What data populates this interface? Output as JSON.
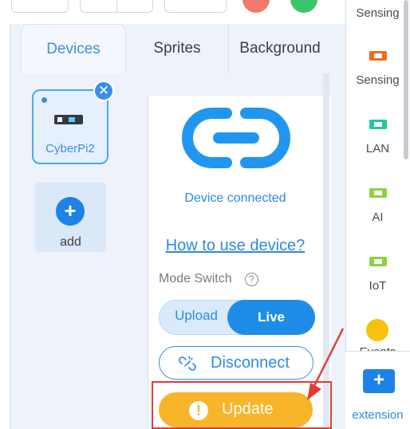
{
  "tabs": [
    {
      "label": "Devices",
      "active": true
    },
    {
      "label": "Sprites",
      "active": false
    },
    {
      "label": "Background",
      "active": false
    }
  ],
  "devices": {
    "items": [
      {
        "name": "CyberPi2",
        "selected": true
      }
    ],
    "add_label": "add",
    "remove_glyph": "✕",
    "add_glyph": "+"
  },
  "device_panel": {
    "status_text": "Device connected",
    "help_link": "How to use device?",
    "mode_switch_label": "Mode Switch",
    "help_glyph": "?",
    "modes": {
      "upload": "Upload",
      "live": "Live",
      "selected": "Live"
    },
    "disconnect_label": "Disconnect",
    "update_label": "Update",
    "update_glyph": "!"
  },
  "categories": [
    {
      "label": "Sensing",
      "icon": "sensing-chip-icon",
      "color": "#ffffff"
    },
    {
      "label": "Sensing",
      "icon": "sensing-chip-icon",
      "color": "#f26a1b"
    },
    {
      "label": "LAN",
      "icon": "lan-chip-icon",
      "color": "#21c9a0"
    },
    {
      "label": "AI",
      "icon": "ai-chip-icon",
      "color": "#8bd33c"
    },
    {
      "label": "IoT",
      "icon": "iot-chip-icon",
      "color": "#8bd33c"
    },
    {
      "label": "Events",
      "icon": "events-dot-icon",
      "color": "#f8c20c"
    }
  ],
  "extension": {
    "label": "extension",
    "glyph": "+"
  },
  "colors": {
    "accent": "#1f8de8",
    "update": "#f8b52a",
    "highlight": "#e53a3a"
  }
}
